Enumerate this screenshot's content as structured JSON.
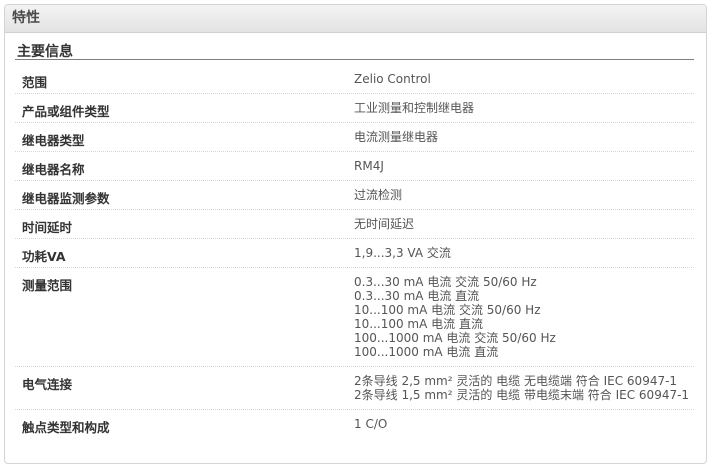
{
  "panel": {
    "title": "特性"
  },
  "section": {
    "title": "主要信息"
  },
  "rows": [
    {
      "label": "范围",
      "values": [
        "Zelio Control"
      ]
    },
    {
      "label": "产品或组件类型",
      "values": [
        "工业测量和控制继电器"
      ]
    },
    {
      "label": "继电器类型",
      "values": [
        "电流测量继电器"
      ]
    },
    {
      "label": "继电器名称",
      "values": [
        "RM4J"
      ]
    },
    {
      "label": "继电器监测参数",
      "values": [
        "过流检测"
      ]
    },
    {
      "label": "时间延时",
      "values": [
        "无时间延迟"
      ]
    },
    {
      "label": "功耗VA",
      "values": [
        "1,9...3,3 VA 交流"
      ]
    },
    {
      "label": "测量范围",
      "values": [
        "0.3...30 mA 电流 交流 50/60 Hz",
        "0.3...30 mA 电流 直流",
        "10...100 mA 电流 交流 50/60 Hz",
        "10...100 mA 电流 直流",
        "100...1000 mA 电流 交流 50/60 Hz",
        "100...1000 mA 电流 直流"
      ]
    },
    {
      "label": "电气连接",
      "values": [
        "2条导线 2,5 mm² 灵活的 电缆 无电缆端 符合 IEC 60947-1",
        "2条导线 1,5 mm² 灵活的 电缆 带电缆末端 符合 IEC 60947-1"
      ]
    },
    {
      "label": "触点类型和构成",
      "values": [
        "1 C/O"
      ]
    }
  ]
}
